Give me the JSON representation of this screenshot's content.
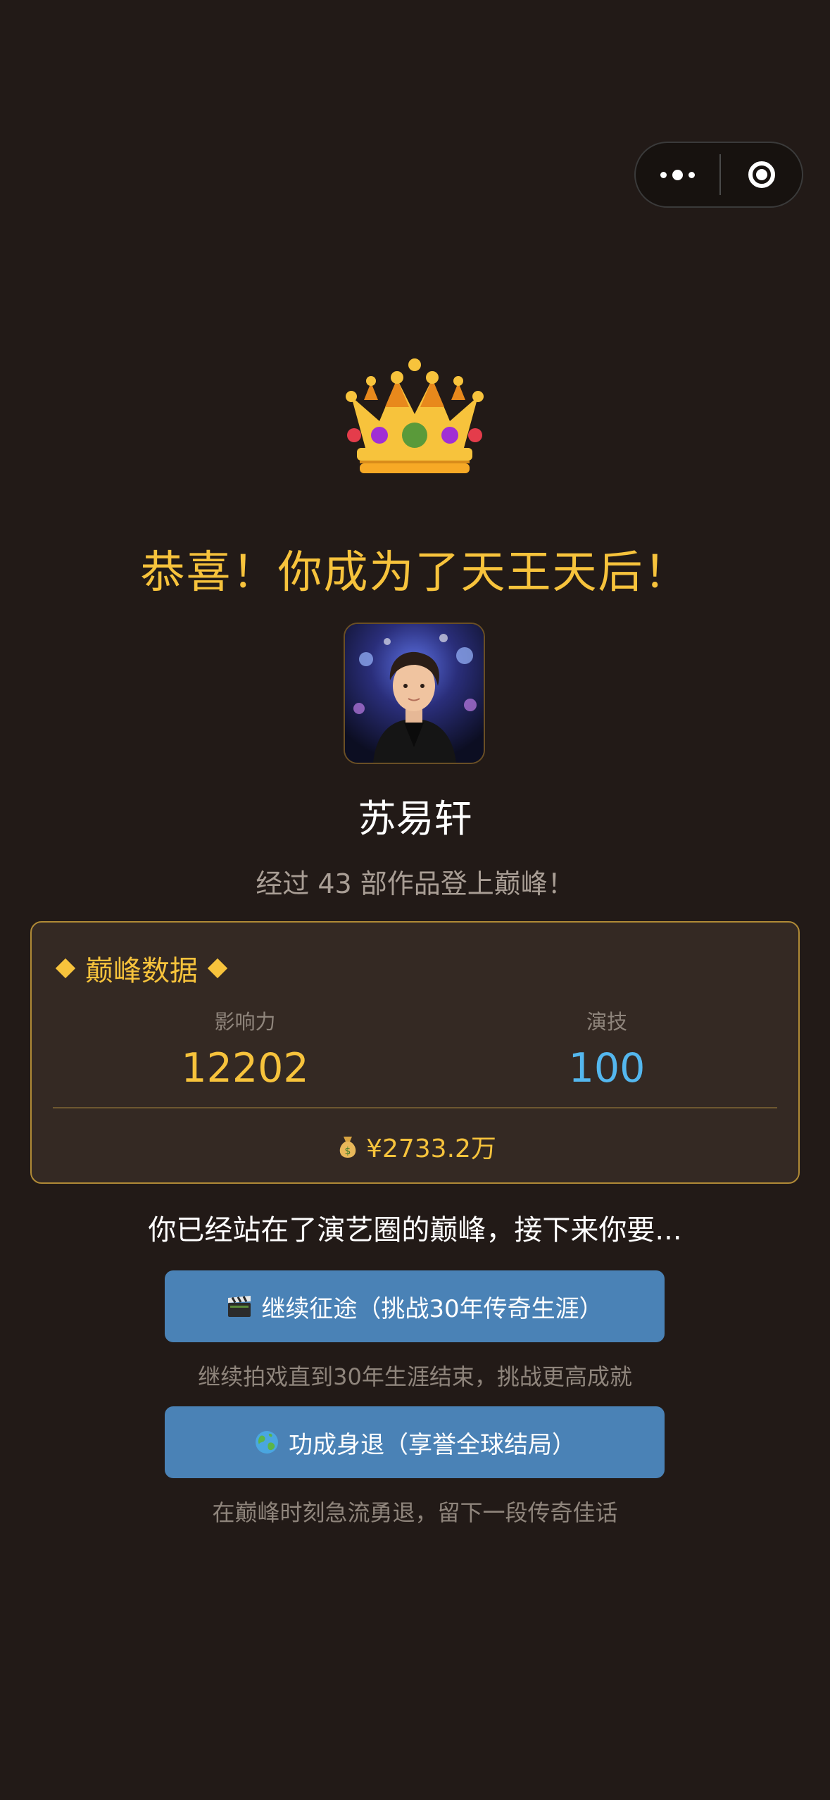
{
  "capsule": {
    "more_icon": "ellipsis-icon",
    "close_icon": "target-close-icon"
  },
  "crown_icon": "crown-icon",
  "title": "恭喜！你成为了天王天后！",
  "player": {
    "name": "苏易轩",
    "avatar": "avatar-man-leather-jacket"
  },
  "subtitle": "经过 43 部作品登上巅峰！",
  "stats": {
    "title": "巅峰数据",
    "influence_label": "影响力",
    "influence_value": "12202",
    "acting_label": "演技",
    "acting_value": "100",
    "money_icon": "money-bag-icon",
    "money": "¥2733.2万"
  },
  "prompt": "你已经站在了演艺圈的巅峰，接下来你要...",
  "choices": [
    {
      "icon": "clapperboard-icon",
      "label": "继续征途（挑战30年传奇生涯）",
      "desc": "继续拍戏直到30年生涯结束，挑战更高成就"
    },
    {
      "icon": "globe-icon",
      "label": "功成身退（享誉全球结局）",
      "desc": "在巅峰时刻急流勇退，留下一段传奇佳话"
    }
  ],
  "colors": {
    "background": "#221a17",
    "gold": "#f7c33c",
    "blue_value": "#54b7ee",
    "button": "#4a82b6"
  }
}
